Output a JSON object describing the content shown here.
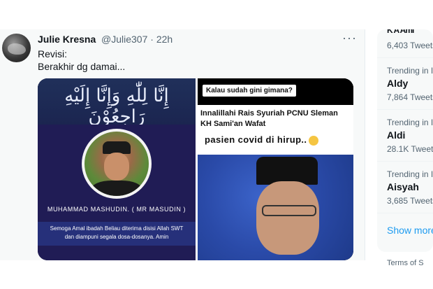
{
  "tweet": {
    "author_name": "Julie Kresna",
    "author_handle": "@Julie307",
    "time": "· 22h",
    "more": "···",
    "text_line1": "Revisi:",
    "text_line2": "Berakhir dg damai..."
  },
  "media_left": {
    "arabic": "إِنَّا لِلّٰهِ وَإِنَّا إِلَيْهِ رَاجِعُوْنَ",
    "deceased_name": "MUHAMMAD MASHUDIN. ( MR MASUDIN )",
    "prayer_line1": "Semoga Amal ibadah Beliau diterima disisi Allah SWT",
    "prayer_line2": "dan diampuni segala dosa-dosanya. Amin"
  },
  "media_right": {
    "caption_box": "Kalau sudah gini gimana?",
    "headline1": "Innalillahi Rais Syuriah PCNU Sleman",
    "headline2": "KH Sami'an Wafat",
    "overlay_text": "pasien covid di hirup.."
  },
  "sidebar": {
    "top_cut_title": "K A Ami",
    "top_cut_count": "6,403 Tweets",
    "trends": [
      {
        "meta": "Trending in I",
        "name": "Aldy",
        "count": "7,864 Tweets"
      },
      {
        "meta": "Trending in I",
        "name": "Aldi",
        "count": "28.1K Tweets"
      },
      {
        "meta": "Trending in I",
        "name": "Aisyah",
        "count": "3,685 Tweets"
      }
    ],
    "show_more": "Show more",
    "footer": "Terms of S"
  }
}
